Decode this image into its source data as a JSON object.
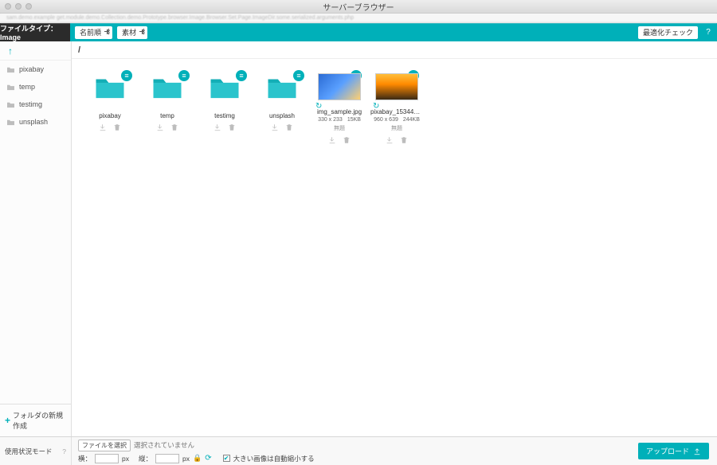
{
  "window": {
    "title": "サーバーブラウザー"
  },
  "address": "sam.demo.example   get.module.demo.Collection.demo.Prototype.browser.Image.Browser.Set.Page.ImageDir.some.serialized.arguments.php",
  "toolbar": {
    "filetype_label": "ファイルタイプ：Image",
    "sort_label": "名前順",
    "category_label": "素材",
    "optimize_label": "最適化チェック",
    "help": "?"
  },
  "sidebar": {
    "up": "↑",
    "items": [
      {
        "label": "pixabay"
      },
      {
        "label": "temp"
      },
      {
        "label": "testimg"
      },
      {
        "label": "unsplash"
      }
    ],
    "new_folder": "フォルダの新規作成"
  },
  "breadcrumb": "/",
  "grid": {
    "folders": [
      {
        "label": "pixabay"
      },
      {
        "label": "temp"
      },
      {
        "label": "testimg"
      },
      {
        "label": "unsplash"
      }
    ],
    "images": [
      {
        "label": "img_sample.jpg",
        "dim": "330 x 233",
        "size": "15KB",
        "status": "無題"
      },
      {
        "label": "pixabay_15344053…",
        "dim": "960 x 639",
        "size": "244KB",
        "status": "無題"
      }
    ]
  },
  "footer": {
    "mode": "使用状況モード",
    "mode_help": "?",
    "choose_file": "ファイルを選択",
    "no_file": "選択されていません",
    "width_label": "横：",
    "height_label": "縦：",
    "px": "px",
    "shrink_label": "大きい画像は自動縮小する",
    "upload": "アップロード"
  }
}
